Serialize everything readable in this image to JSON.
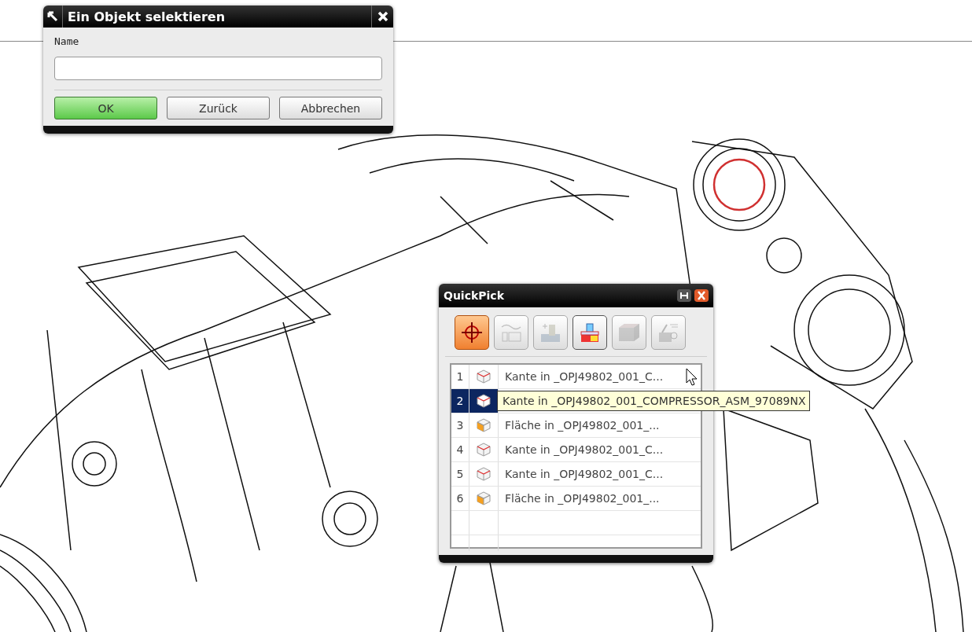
{
  "select_dialog": {
    "title": "Ein Objekt selektieren",
    "field_label": "Name",
    "buttons": [
      {
        "label": "OK",
        "kind": "default"
      },
      {
        "label": "Zurück",
        "kind": "normal"
      },
      {
        "label": "Abbrechen",
        "kind": "normal"
      }
    ]
  },
  "quickpick": {
    "title": "QuickPick",
    "filters": [
      {
        "kind": "point",
        "selected": true,
        "disabled": false
      },
      {
        "kind": "curve",
        "selected": false,
        "disabled": true
      },
      {
        "kind": "feature",
        "selected": false,
        "disabled": true
      },
      {
        "kind": "body",
        "selected": false,
        "disabled": false
      },
      {
        "kind": "solid",
        "selected": false,
        "disabled": true
      },
      {
        "kind": "component",
        "selected": false,
        "disabled": true
      }
    ],
    "rows": [
      {
        "index": "1",
        "kind": "edge",
        "label": "Kante in _OPJ49802_001_C...",
        "selected": false
      },
      {
        "index": "2",
        "kind": "edge",
        "label": "Kante in _OPJ49802_001_COMPRESSOR_ASM_97089NX",
        "selected": true
      },
      {
        "index": "3",
        "kind": "face",
        "label": "Fläche in _OPJ49802_001_...",
        "selected": false
      },
      {
        "index": "4",
        "kind": "edge",
        "label": "Kante in _OPJ49802_001_C...",
        "selected": false
      },
      {
        "index": "5",
        "kind": "edge",
        "label": "Kante in _OPJ49802_001_C...",
        "selected": false
      },
      {
        "index": "6",
        "kind": "face",
        "label": "Fläche in _OPJ49802_001_...",
        "selected": false
      }
    ]
  }
}
